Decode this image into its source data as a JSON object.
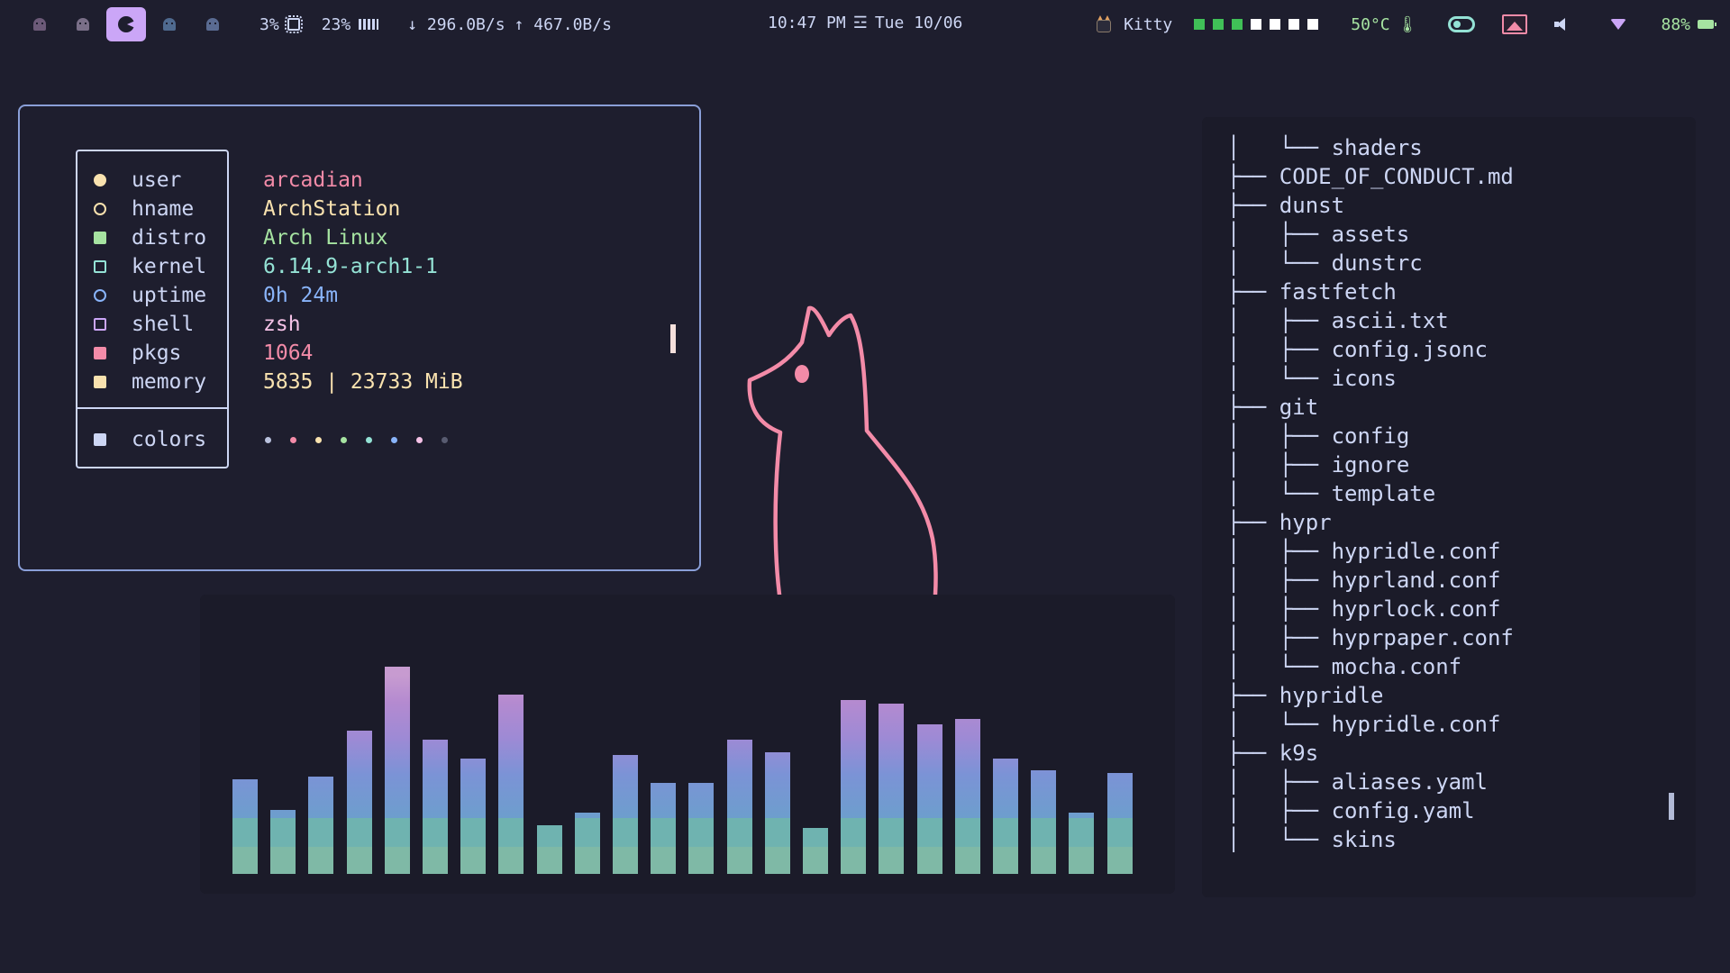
{
  "topbar": {
    "workspaces": [
      {
        "icon": "ghost-icon",
        "color": "#6c5a78",
        "active": false
      },
      {
        "icon": "ghost-icon",
        "color": "#7a6f88",
        "active": false
      },
      {
        "icon": "pacman-icon",
        "color": "#cba6f7",
        "active": true
      },
      {
        "icon": "ghost-icon",
        "color": "#4f6a8f",
        "active": false
      },
      {
        "icon": "ghost-icon",
        "color": "#5a6b92",
        "active": false
      }
    ],
    "cpu": "3%",
    "ram": "23%",
    "net_down": "↓ 296.0B/s",
    "net_up": "↑ 467.0B/s",
    "time": "10:47 PM",
    "date_sep": "☲",
    "date": "Tue 10/06",
    "active_window": "Kitty",
    "workspace_squares": [
      "#40c057",
      "#40c057",
      "#40c057",
      "#ffffff",
      "#ffffff",
      "#ffffff",
      "#ffffff"
    ],
    "temperature": "50°C",
    "battery": "88%"
  },
  "fastfetch": {
    "rows": [
      {
        "icon": "user-icon",
        "icon_color": "#f9e2af",
        "key": "user",
        "value": "arcadian",
        "value_color": "#f38ba8"
      },
      {
        "icon": "host-icon",
        "icon_color": "#f9e2af",
        "key": "hname",
        "value": "ArchStation",
        "value_color": "#f9e2af"
      },
      {
        "icon": "linux-icon",
        "icon_color": "#a6e3a1",
        "key": "distro",
        "value": "Arch Linux",
        "value_color": "#a6e3a1"
      },
      {
        "icon": "laptop-icon",
        "icon_color": "#94e2d5",
        "key": "kernel",
        "value": "6.14.9-arch1-1",
        "value_color": "#94e2d5"
      },
      {
        "icon": "clock-icon",
        "icon_color": "#89b4fa",
        "key": "uptime",
        "value": "0h 24m",
        "value_color": "#89b4fa"
      },
      {
        "icon": "terminal-icon",
        "icon_color": "#cba6f7",
        "key": "shell",
        "value": "zsh",
        "value_color": "#f5c2e7"
      },
      {
        "icon": "package-icon",
        "icon_color": "#f38ba8",
        "key": "pkgs",
        "value": "1064",
        "value_color": "#f38ba8"
      },
      {
        "icon": "memory-icon",
        "icon_color": "#f9e2af",
        "key": "memory",
        "value": "5835 | 23733 MiB",
        "value_color": "#f9e2af"
      }
    ],
    "colors_row": {
      "icon": "palette-icon",
      "key": "colors"
    },
    "palette": [
      "#bac2de",
      "#f38ba8",
      "#f9e2af",
      "#a6e3a1",
      "#94e2d5",
      "#89b4fa",
      "#f5c2e7",
      "#585b70"
    ]
  },
  "visualizer": {
    "levels": [
      0.31,
      0.21,
      0.32,
      0.47,
      0.68,
      0.44,
      0.38,
      0.59,
      0.16,
      0.2,
      0.39,
      0.3,
      0.3,
      0.44,
      0.4,
      0.15,
      0.57,
      0.56,
      0.49,
      0.51,
      0.38,
      0.34,
      0.2,
      0.33
    ]
  },
  "tree": {
    "lines": [
      {
        "prefix": "│   └── ",
        "name": "shaders"
      },
      {
        "prefix": "├── ",
        "name": "CODE_OF_CONDUCT.md"
      },
      {
        "prefix": "├── ",
        "name": "dunst"
      },
      {
        "prefix": "│   ├── ",
        "name": "assets"
      },
      {
        "prefix": "│   └── ",
        "name": "dunstrc"
      },
      {
        "prefix": "├── ",
        "name": "fastfetch"
      },
      {
        "prefix": "│   ├── ",
        "name": "ascii.txt"
      },
      {
        "prefix": "│   ├── ",
        "name": "config.jsonc"
      },
      {
        "prefix": "│   └── ",
        "name": "icons"
      },
      {
        "prefix": "├── ",
        "name": "git"
      },
      {
        "prefix": "│   ├── ",
        "name": "config"
      },
      {
        "prefix": "│   ├── ",
        "name": "ignore"
      },
      {
        "prefix": "│   └── ",
        "name": "template"
      },
      {
        "prefix": "├── ",
        "name": "hypr"
      },
      {
        "prefix": "│   ├── ",
        "name": "hypridle.conf"
      },
      {
        "prefix": "│   ├── ",
        "name": "hyprland.conf"
      },
      {
        "prefix": "│   ├── ",
        "name": "hyprlock.conf"
      },
      {
        "prefix": "│   ├── ",
        "name": "hyprpaper.conf"
      },
      {
        "prefix": "│   └── ",
        "name": "mocha.conf"
      },
      {
        "prefix": "├── ",
        "name": "hypridle"
      },
      {
        "prefix": "│   └── ",
        "name": "hypridle.conf"
      },
      {
        "prefix": "├── ",
        "name": "k9s"
      },
      {
        "prefix": "│   ├── ",
        "name": "aliases.yaml"
      },
      {
        "prefix": "│   ├── ",
        "name": "config.yaml"
      },
      {
        "prefix": "│   └── ",
        "name": "skins"
      }
    ]
  },
  "theme": {
    "accent": "#cba6f7",
    "background": "#1e1e2e",
    "cat_stroke": "#f38ba8"
  }
}
